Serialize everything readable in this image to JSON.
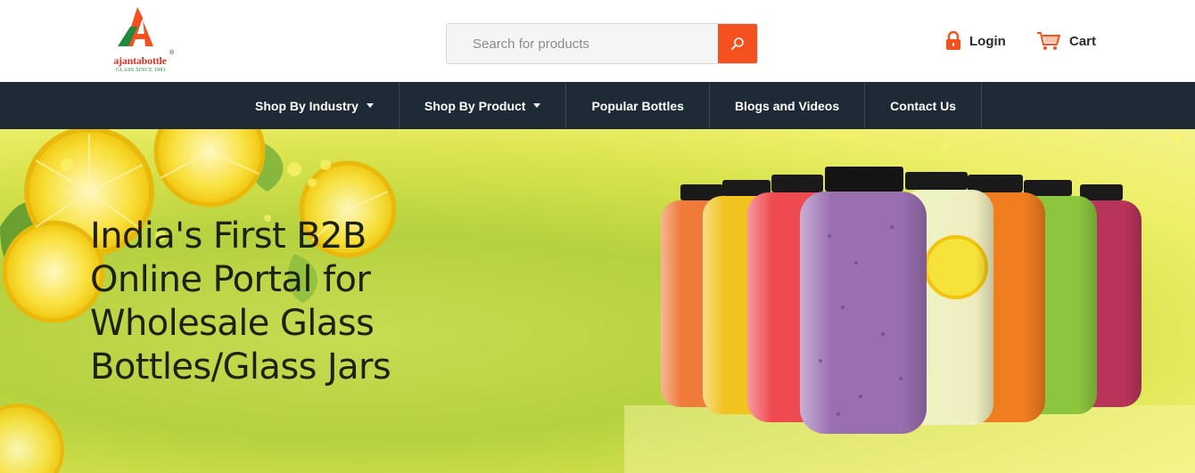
{
  "brand": {
    "name": "ajantabottle",
    "registered": "®",
    "tagline": "GLASS SINCE 1981",
    "colors": {
      "orange": "#f4511e",
      "green": "#1f8a3c",
      "red": "#d8352a"
    }
  },
  "search": {
    "placeholder": "Search for products",
    "value": "",
    "icon": "search-icon"
  },
  "account": {
    "login_label": "Login",
    "login_icon": "lock-icon",
    "cart_label": "Cart",
    "cart_icon": "cart-icon"
  },
  "nav": {
    "background": "#1f2a37",
    "items": [
      {
        "label": "Shop By Industry",
        "dropdown": true
      },
      {
        "label": "Shop By Product",
        "dropdown": true
      },
      {
        "label": "Popular Bottles",
        "dropdown": false
      },
      {
        "label": "Blogs and Videos",
        "dropdown": false
      },
      {
        "label": "Contact Us",
        "dropdown": false
      }
    ]
  },
  "hero": {
    "title_lines": [
      "India's First B2B",
      "Online Portal for",
      "Wholesale Glass",
      "Bottles/Glass Jars"
    ],
    "image": "juice-bottles-image",
    "bottle_colors": [
      "#f07a3a",
      "#f2c21f",
      "#ef4a4f",
      "#9a6fb0",
      "#eef3c8",
      "#f07d1f",
      "#8cc63f",
      "#b8345a"
    ]
  }
}
